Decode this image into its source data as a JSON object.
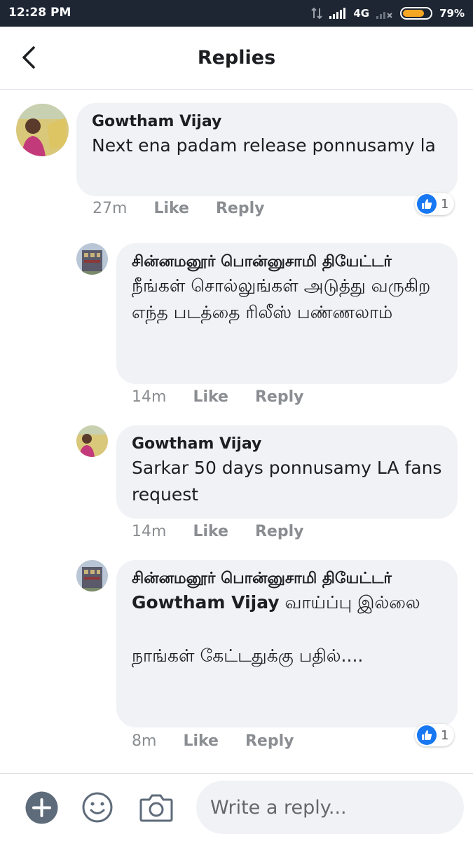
{
  "status_bar": {
    "time": "12:28 PM",
    "network": "4G",
    "battery": "79%",
    "battery_level": 0.79
  },
  "header": {
    "title": "Replies"
  },
  "comments": [
    {
      "author": "Gowtham Vijay",
      "text": "Next ena padam release ponnusamy la",
      "time": "27m",
      "like_label": "Like",
      "reply_label": "Reply",
      "reaction_count": "1"
    },
    {
      "author": "சின்னமனூர் பொன்னுசாமி தியேட்டர்",
      "text": "நீங்கள் சொல்லுங்கள் அடுத்து வருகிற எந்த படத்தை ரிலீஸ் பண்ணலாம்",
      "time": "14m",
      "like_label": "Like",
      "reply_label": "Reply"
    },
    {
      "author": "Gowtham Vijay",
      "text": "Sarkar 50 days ponnusamy LA fans request",
      "time": "14m",
      "like_label": "Like",
      "reply_label": "Reply"
    },
    {
      "author": "சின்னமனூர் பொன்னுசாமி தியேட்டர்",
      "mention": "Gowtham Vijay",
      "text": " வாய்ப்பு இல்லை",
      "text2": "நாங்கள் கேட்டதுக்கு பதில்....",
      "time": "8m",
      "like_label": "Like",
      "reply_label": "Reply",
      "reaction_count": "1"
    }
  ],
  "composer": {
    "placeholder": "Write a reply...",
    "icons": [
      "add-icon",
      "emoji-icon",
      "camera-icon"
    ]
  },
  "colors": {
    "status_bar_bg": "#1e2634",
    "bubble_bg": "#f0f2f5",
    "like_blue": "#1877f2",
    "battery_orange": "#f5a623",
    "meta_gray": "#8a8d91"
  }
}
